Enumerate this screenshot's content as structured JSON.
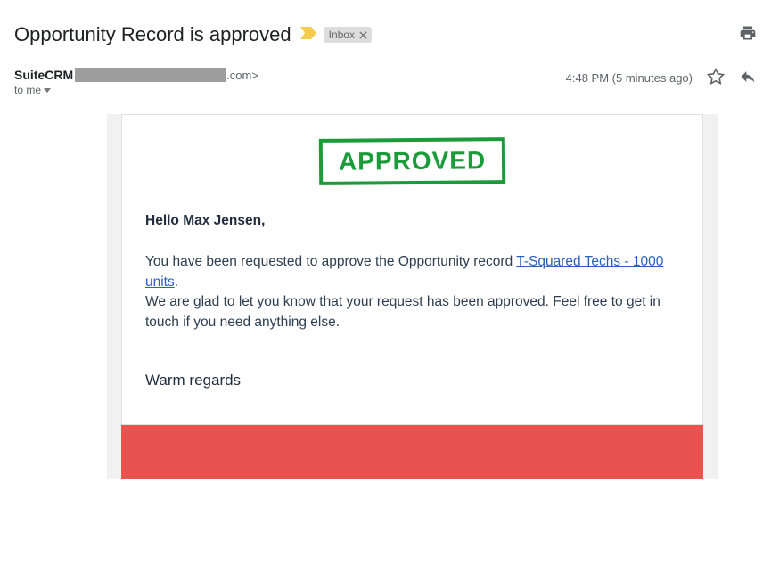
{
  "header": {
    "subject": "Opportunity Record is approved",
    "label": "Inbox"
  },
  "meta": {
    "sender_name": "SuiteCRM",
    "sender_suffix": ".com>",
    "to_text": "to me",
    "timestamp": "4:48 PM (5 minutes ago)"
  },
  "email": {
    "stamp": "APPROVED",
    "greeting": "Hello Max Jensen,",
    "line1_a": "You have been requested to approve the Opportunity record ",
    "record_link": "T-Squared Techs - 1000 units",
    "line1_b": ".",
    "line2": "We are glad to let you know that your request has been approved. Feel free to get in touch if you need anything else.",
    "signoff": "Warm regards"
  }
}
